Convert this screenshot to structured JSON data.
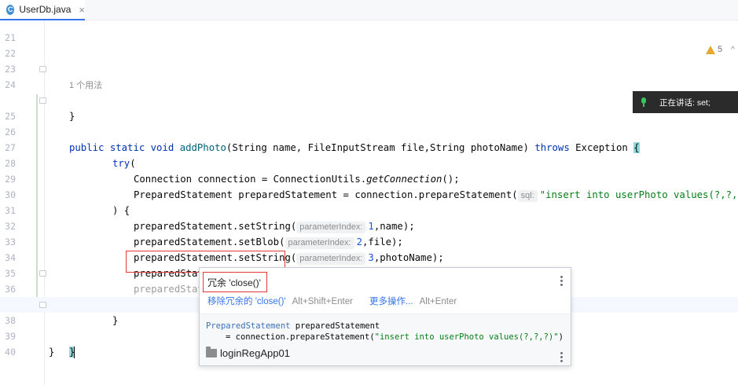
{
  "tab": {
    "icon_letter": "C",
    "label": "UserDb.java",
    "close": "×"
  },
  "inspection": {
    "warning_count": "5",
    "chevron": "^"
  },
  "usages_hint": "1 个用法",
  "lines": {
    "l21": "21",
    "l22": "22",
    "l23": "23",
    "l24": "24",
    "l25": "25",
    "l26": "26",
    "l27": "27",
    "l28": "28",
    "l29": "29",
    "l30": "30",
    "l31": "31",
    "l32": "32",
    "l33": "33",
    "l34": "34",
    "l35": "35",
    "l36": "36",
    "l37": "37",
    "l38": "38",
    "l39": "39",
    "l40": "40"
  },
  "code": {
    "close_brace": "}",
    "public": "public",
    "static": "static",
    "void": "void",
    "addPhoto": "addPhoto",
    "sig_params": "(String name, FileInputStream file,String photoName) ",
    "throws": "throws",
    "exception": " Exception ",
    "open_brace": "{",
    "try": "try",
    "paren_open": "(",
    "conn_decl": "Connection connection = ConnectionUtils.",
    "getConnection": "getConnection",
    "call_end": "();",
    "ps_decl": "PreparedStatement preparedStatement = connection.prepareStatement(",
    "hint_sql": "sql:",
    "sql_string": "\"insert into userPhoto values(?,?,?)\"",
    "stmt_end": ");",
    "try_close": ") {",
    "set_string": "preparedStatement.setString(",
    "set_blob": "preparedStatement.setBlob(",
    "hint_param_index": "parameterIndex:",
    "n1": "1",
    "n2": "2",
    "n3": "3",
    "arg_name": ",name);",
    "arg_file": ",file);",
    "arg_photo": ",photoName);",
    "execute_update": "preparedStatement.executeUpdate();",
    "close_call": "preparedStatement.close();"
  },
  "speech": {
    "text": "正在讲话: set;"
  },
  "popup": {
    "title": "冗余 'close()'",
    "action_remove": "移除冗余的 'close()'",
    "action_remove_shortcut": "Alt+Shift+Enter",
    "action_more": "更多操作...",
    "action_more_shortcut": "Alt+Enter",
    "doc_type": "PreparedStatement",
    "doc_var": " preparedStatement",
    "doc_assign": "= connection.prepareStatement(",
    "doc_sql": "\"insert into userPhoto values(?,?,?)\"",
    "doc_end": ")",
    "module": "loginRegApp01"
  },
  "colors": {
    "keyword": "#0033b3",
    "method": "#00627a",
    "string": "#067d17",
    "number": "#1750eb",
    "link": "#3574f0",
    "highlight_box": "#e53935",
    "warning": "#e6a82e"
  }
}
